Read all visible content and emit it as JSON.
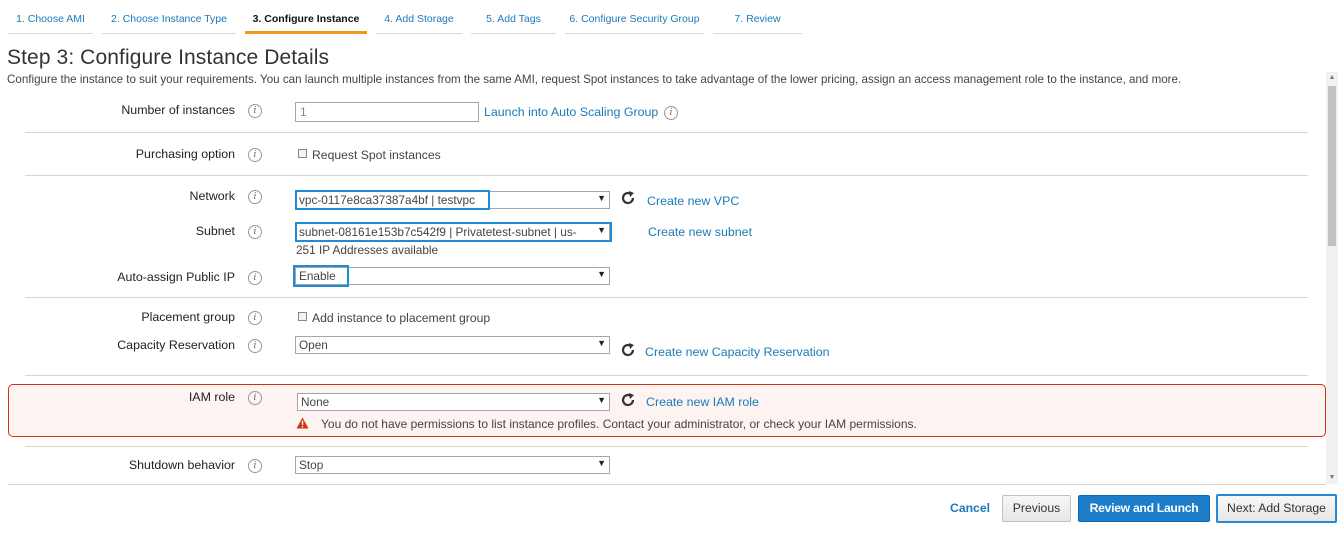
{
  "wizard": {
    "tabs": [
      {
        "label": "1. Choose AMI"
      },
      {
        "label": "2. Choose Instance Type"
      },
      {
        "label": "3. Configure Instance"
      },
      {
        "label": "4. Add Storage"
      },
      {
        "label": "5. Add Tags"
      },
      {
        "label": "6. Configure Security Group"
      },
      {
        "label": "7. Review"
      }
    ],
    "active_tab_index": 2
  },
  "page": {
    "title": "Step 3: Configure Instance Details",
    "description": "Configure the instance to suit your requirements. You can launch multiple instances from the same AMI, request Spot instances to take advantage of the lower pricing, assign an access management role to the instance, and more."
  },
  "form": {
    "number_of_instances": {
      "label": "Number of instances",
      "value": "1",
      "link": "Launch into Auto Scaling Group"
    },
    "purchasing_option": {
      "label": "Purchasing option",
      "checkbox_label": "Request Spot instances",
      "checked": false
    },
    "network": {
      "label": "Network",
      "value": "vpc-0117e8ca37387a4bf | testvpc",
      "link": "Create new VPC"
    },
    "subnet": {
      "label": "Subnet",
      "value": "subnet-08161e153b7c542f9 | Privatetest-subnet | us-",
      "link": "Create new subnet",
      "hint": "251 IP Addresses available"
    },
    "auto_assign_ip": {
      "label": "Auto-assign Public IP",
      "value": "Enable"
    },
    "placement_group": {
      "label": "Placement group",
      "checkbox_label": "Add instance to placement group",
      "checked": false
    },
    "capacity_reservation": {
      "label": "Capacity Reservation",
      "value": "Open",
      "link": "Create new Capacity Reservation"
    },
    "iam_role": {
      "label": "IAM role",
      "value": "None",
      "link": "Create new IAM role",
      "error": "You do not have permissions to list instance profiles. Contact your administrator, or check your IAM permissions."
    },
    "shutdown_behavior": {
      "label": "Shutdown behavior",
      "value": "Stop"
    }
  },
  "footer": {
    "cancel": "Cancel",
    "previous": "Previous",
    "review_launch": "Review and Launch",
    "next": "Next: Add Storage"
  },
  "icons": {
    "info": "i",
    "select_arrow": "▼",
    "scroll_up": "▲",
    "scroll_down": "▼"
  },
  "colors": {
    "link": "#1a7bb9",
    "active_tab_underline": "#ec9a1f",
    "highlight": "#1f8dd6",
    "error_border": "#d13212",
    "primary_button": "#1d7dc8"
  }
}
